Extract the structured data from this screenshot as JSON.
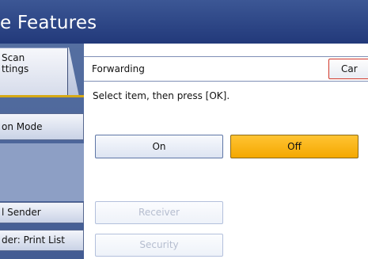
{
  "header": {
    "title": "e Features"
  },
  "sidebar": {
    "scan_tab": {
      "line1": "Scan",
      "line2": "ttings"
    },
    "items": [
      {
        "label": "on Mode"
      },
      {
        "label": "l Sender"
      },
      {
        "label": "der: Print List"
      }
    ]
  },
  "dialog": {
    "title": "Forwarding",
    "cancel_label": "Car",
    "instruction": "Select item, then press [OK].",
    "options": {
      "on": "On",
      "off": "Off",
      "selected": "Off"
    },
    "disabled_buttons": {
      "receiver": "Receiver",
      "security": "Security"
    }
  },
  "colors": {
    "header": "#2d4585",
    "selected": "#f8b316",
    "accent_line": "#d6a916"
  }
}
